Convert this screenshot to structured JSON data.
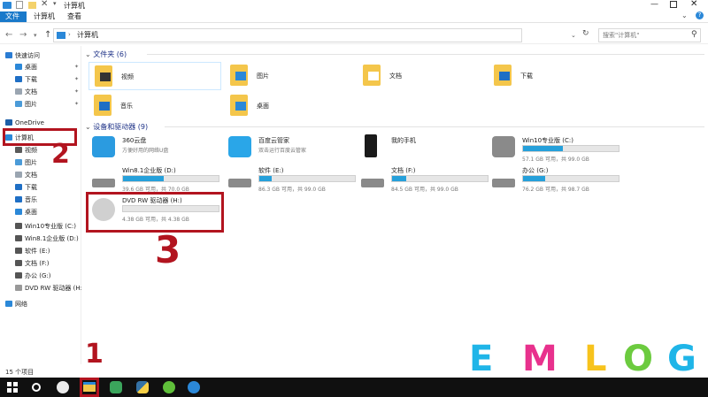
{
  "window": {
    "title": "计算机"
  },
  "ribbon": {
    "tabs": [
      "文件",
      "计算机",
      "查看"
    ]
  },
  "address": {
    "path": "计算机",
    "search_placeholder": "搜索\"计算机\""
  },
  "sidebar": {
    "items": [
      {
        "label": "快速访问",
        "icon": "star-icon",
        "color": "#2b7cd3",
        "pinned": false
      },
      {
        "label": "桌面",
        "icon": "desktop-icon",
        "color": "#2b88d8",
        "pinned": true
      },
      {
        "label": "下载",
        "icon": "download-icon",
        "color": "#1f6fc5",
        "pinned": true
      },
      {
        "label": "文档",
        "icon": "document-icon",
        "color": "#9aa5b1",
        "pinned": true
      },
      {
        "label": "图片",
        "icon": "picture-icon",
        "color": "#4b9bd8",
        "pinned": true
      },
      {
        "label": "OneDrive",
        "icon": "cloud-icon",
        "color": "#1c5fa8",
        "pinned": false
      },
      {
        "label": "计算机",
        "icon": "computer-icon",
        "color": "#2b88d8",
        "pinned": false
      },
      {
        "label": "视频",
        "icon": "video-icon",
        "color": "#5a5a5a",
        "pinned": false
      },
      {
        "label": "图片",
        "icon": "picture-icon",
        "color": "#4b9bd8",
        "pinned": false
      },
      {
        "label": "文档",
        "icon": "document-icon",
        "color": "#9aa5b1",
        "pinned": false
      },
      {
        "label": "下载",
        "icon": "download-icon",
        "color": "#1f6fc5",
        "pinned": false
      },
      {
        "label": "音乐",
        "icon": "music-icon",
        "color": "#1f6fc5",
        "pinned": false
      },
      {
        "label": "桌面",
        "icon": "desktop-icon",
        "color": "#2b88d8",
        "pinned": false
      },
      {
        "label": "Win10专业版 (C:)",
        "icon": "drive-icon",
        "color": "#555",
        "pinned": false
      },
      {
        "label": "Win8.1企业版 (D:)",
        "icon": "drive-icon",
        "color": "#555",
        "pinned": false
      },
      {
        "label": "软件 (E:)",
        "icon": "drive-icon",
        "color": "#555",
        "pinned": false
      },
      {
        "label": "文档 (F:)",
        "icon": "drive-icon",
        "color": "#555",
        "pinned": false
      },
      {
        "label": "办公 (G:)",
        "icon": "drive-icon",
        "color": "#555",
        "pinned": false
      },
      {
        "label": "DVD RW 驱动器 (H:",
        "icon": "dvd-icon",
        "color": "#999",
        "pinned": false
      },
      {
        "label": "网络",
        "icon": "network-icon",
        "color": "#2b88d8",
        "pinned": false
      }
    ]
  },
  "folders": {
    "header": "文件夹 (6)",
    "items": [
      {
        "label": "视频",
        "icon": "video-folder-icon"
      },
      {
        "label": "图片",
        "icon": "picture-folder-icon"
      },
      {
        "label": "文档",
        "icon": "document-folder-icon"
      },
      {
        "label": "下载",
        "icon": "download-folder-icon"
      },
      {
        "label": "音乐",
        "icon": "music-folder-icon"
      },
      {
        "label": "桌面",
        "icon": "desktop-folder-icon"
      }
    ]
  },
  "devices": {
    "header": "设备和驱动器 (9)",
    "items": [
      {
        "name": "360云盘",
        "sub": "方便好用的网络U盘",
        "icon": "cloud-drive-icon",
        "used": null
      },
      {
        "name": "百度云管家",
        "sub": "双击运行百度云管家",
        "icon": "baidu-cloud-icon",
        "used": null
      },
      {
        "name": "我的手机",
        "sub": "",
        "icon": "phone-icon",
        "used": null
      },
      {
        "name": "Win10专业版 (C:)",
        "sub": "57.1 GB 可用，共 99.0 GB",
        "icon": "windows-drive-icon",
        "used": 0.42
      },
      {
        "name": "Win8.1企业版 (D:)",
        "sub": "39.6 GB 可用，共 70.0 GB",
        "icon": "drive-icon",
        "used": 0.43
      },
      {
        "name": "软件 (E:)",
        "sub": "86.3 GB 可用，共 99.0 GB",
        "icon": "drive-icon",
        "used": 0.13
      },
      {
        "name": "文档 (F:)",
        "sub": "84.5 GB 可用，共 99.0 GB",
        "icon": "drive-icon",
        "used": 0.15
      },
      {
        "name": "办公 (G:)",
        "sub": "76.2 GB 可用，共 98.7 GB",
        "icon": "drive-icon",
        "used": 0.23
      },
      {
        "name": "DVD RW 驱动器 (H:)",
        "sub": "4.38 GB 可用，共 4.38 GB",
        "icon": "dvd-icon",
        "used": 0.0
      }
    ]
  },
  "status": {
    "count": "15 个项目"
  },
  "annotations": {
    "n1": "1",
    "n2": "2",
    "n3": "3"
  },
  "watermark": {
    "letters": [
      "E",
      "M",
      "L",
      "O",
      "G"
    ],
    "colors": [
      "#1fb5e8",
      "#e8318d",
      "#f7c31c",
      "#6ccb3f",
      "#1fb5e8"
    ]
  },
  "accent": "#26a0da"
}
